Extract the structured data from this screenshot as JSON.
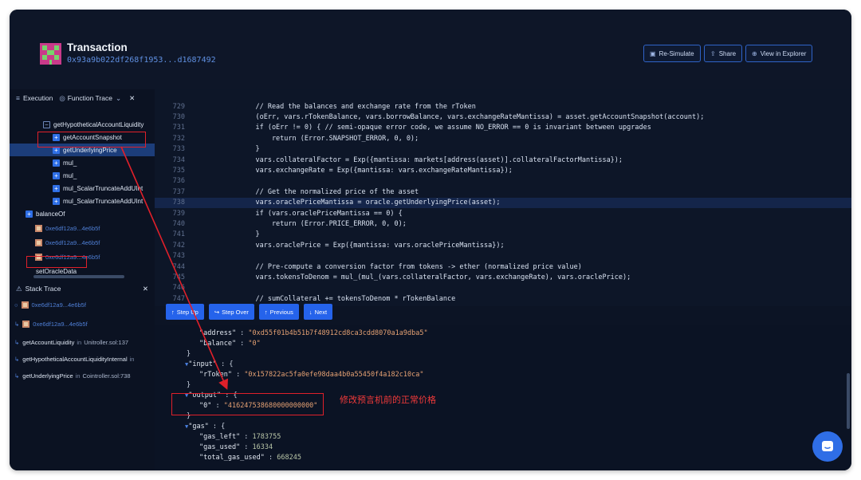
{
  "header": {
    "title": "Transaction",
    "hash": "0x93a9b022df268f1953...d1687492",
    "buttons": {
      "resimulate": "Re-Simulate",
      "share": "Share",
      "explorer": "View in Explorer"
    }
  },
  "tree": {
    "tab_execution": "Execution",
    "tab_function_trace": "Function Trace",
    "items": [
      "getHypotheticalAccountLiquidity",
      "getAccountSnapshot",
      "getUnderlyingPrice",
      "mul_",
      "mul_",
      "mul_ScalarTruncateAddUInt",
      "mul_ScalarTruncateAddUInt",
      "balanceOf",
      "0xe6df12a9...4e6b5f",
      "0xe6df12a9...4e6b5f",
      "0xe6df12a9...4e6b5f",
      "setOracleData"
    ]
  },
  "stack": {
    "title": "Stack Trace",
    "rows": [
      {
        "name": "0xe6df12a9...4e6b5f"
      },
      {
        "name": "0xe6df12a9...4e6b5f"
      },
      {
        "name": "getAccountLiquidity",
        "in": "in",
        "loc": "Unitroller.sol:137"
      },
      {
        "name": "getHypotheticalAccountLiquidityInternal",
        "in": "in",
        "loc": ""
      },
      {
        "name": "getUnderlyingPrice",
        "in": "in",
        "loc": "Cointroller.sol:738"
      }
    ]
  },
  "code": {
    "lines": [
      {
        "n": "729",
        "t": "    // Read the balances and exchange rate from the rToken",
        "type": "com"
      },
      {
        "n": "730",
        "t": "    (oErr, vars.rTokenBalance, vars.borrowBalance, vars.exchangeRateMantissa) = asset.getAccountSnapshot(account);",
        "type": "code"
      },
      {
        "n": "731",
        "t": "    if (oErr != 0) { // semi-opaque error code, we assume NO_ERROR == 0 is invariant between upgrades",
        "type": "code"
      },
      {
        "n": "732",
        "t": "        return (Error.SNAPSHOT_ERROR, 0, 0);",
        "type": "code"
      },
      {
        "n": "733",
        "t": "    }",
        "type": "code"
      },
      {
        "n": "734",
        "t": "    vars.collateralFactor = Exp({mantissa: markets[address(asset)].collateralFactorMantissa});",
        "type": "code"
      },
      {
        "n": "735",
        "t": "    vars.exchangeRate = Exp({mantissa: vars.exchangeRateMantissa});",
        "type": "code"
      },
      {
        "n": "736",
        "t": "",
        "type": "code"
      },
      {
        "n": "737",
        "t": "    // Get the normalized price of the asset",
        "type": "com"
      },
      {
        "n": "738",
        "t": "    vars.oraclePriceMantissa = oracle.getUnderlyingPrice(asset);",
        "type": "hl"
      },
      {
        "n": "739",
        "t": "    if (vars.oraclePriceMantissa == 0) {",
        "type": "code"
      },
      {
        "n": "740",
        "t": "        return (Error.PRICE_ERROR, 0, 0);",
        "type": "code"
      },
      {
        "n": "741",
        "t": "    }",
        "type": "code"
      },
      {
        "n": "742",
        "t": "    vars.oraclePrice = Exp({mantissa: vars.oraclePriceMantissa});",
        "type": "code"
      },
      {
        "n": "743",
        "t": "",
        "type": "code"
      },
      {
        "n": "744",
        "t": "    // Pre-compute a conversion factor from tokens -> ether (normalized price value)",
        "type": "com"
      },
      {
        "n": "745",
        "t": "    vars.tokensToDenom = mul_(mul_(vars.collateralFactor, vars.exchangeRate), vars.oraclePrice);",
        "type": "code"
      },
      {
        "n": "746",
        "t": "",
        "type": "code"
      },
      {
        "n": "747",
        "t": "    // sumCollateral += tokensToDenom * rTokenBalance",
        "type": "com"
      }
    ]
  },
  "controls": {
    "step_up": "Step Up",
    "step_over": "Step Over",
    "previous": "Previous",
    "next": "Next"
  },
  "json": {
    "address_key": "\"address\"",
    "address_val": "\"0xd55f01b4b51b7f48912cd8ca3cdd8070a1a9dba5\"",
    "balance_key": "\"balance\"",
    "balance_val": "\"0\"",
    "input_key": "\"input\"",
    "rtoken_key": "\"rToken\"",
    "rtoken_val": "\"0x157822ac5fa0efe98daa4b0a55450f4a182c10ca\"",
    "output_key": "\"output\"",
    "out0_key": "\"0\"",
    "out0_val": "\"416247538680000000000\"",
    "gas_key": "\"gas\"",
    "gas_left_key": "\"gas_left\"",
    "gas_left_val": "1783755",
    "gas_used_key": "\"gas_used\"",
    "gas_used_val": "16334",
    "total_gas_key": "\"total_gas_used\"",
    "total_gas_val": "668245"
  },
  "annotation": "修改预言机前的正常价格",
  "colors": {
    "accent": "#2563eb",
    "background": "#0c1425",
    "annotation": "#e0202a"
  }
}
